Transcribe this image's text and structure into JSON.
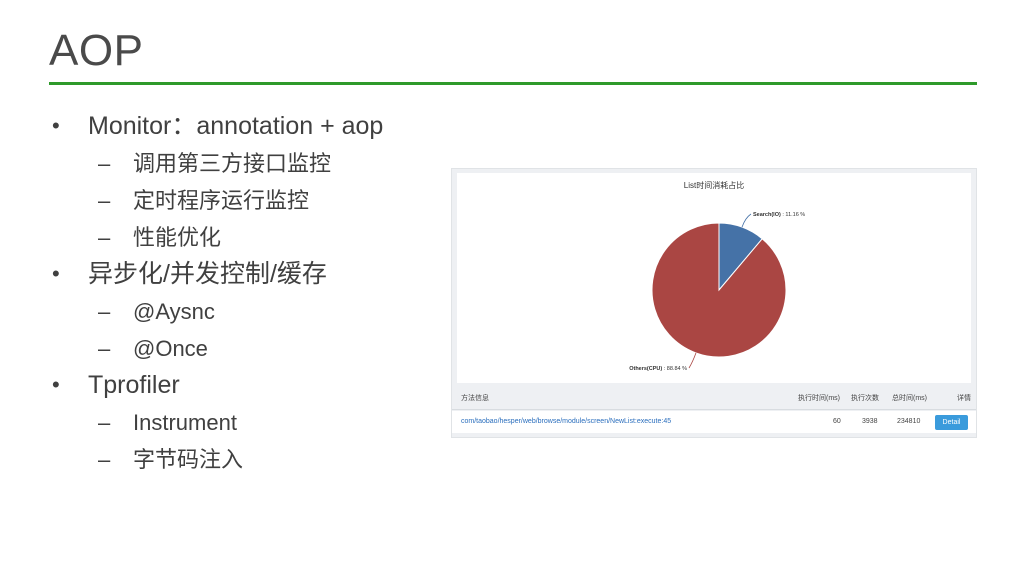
{
  "slide": {
    "title": "AOP",
    "bullets": [
      {
        "level": 1,
        "text": "Monitor：annotation + aop"
      },
      {
        "level": 2,
        "text": "调用第三方接口监控"
      },
      {
        "level": 2,
        "text": "定时程序运行监控"
      },
      {
        "level": 2,
        "text": "性能优化"
      },
      {
        "level": 1,
        "text": "异步化/并发控制/缓存"
      },
      {
        "level": 2,
        "text": "@Aysnc"
      },
      {
        "level": 2,
        "text": "@Once"
      },
      {
        "level": 1,
        "text": "Tprofiler"
      },
      {
        "level": 2,
        "text": "Instrument"
      },
      {
        "level": 2,
        "text": "字节码注入"
      }
    ],
    "markers": {
      "level1": "•",
      "level2": "–"
    },
    "accent_color": "#2e9a2a"
  },
  "screenshot": {
    "chart_title": "List时间消耗占比",
    "table": {
      "headers": [
        "方法信息",
        "执行时间(ms)",
        "执行次数",
        "总时间(ms)",
        "详情"
      ],
      "row": {
        "method": "com/taobao/hesper/web/browse/module/screen/NewList:execute:45",
        "exec_time": "60",
        "count": "3938",
        "total_time": "234810",
        "detail_label": "Detail"
      }
    }
  },
  "chart_data": {
    "type": "pie",
    "title": "List时间消耗占比",
    "slices": [
      {
        "label": "Search(IO)",
        "suffix": " : 11.16 %",
        "value": 11.16,
        "color": "#4572a7"
      },
      {
        "label": "Others(CPU)",
        "suffix": " : 88.84 %",
        "value": 88.84,
        "color": "#aa4643"
      }
    ]
  }
}
